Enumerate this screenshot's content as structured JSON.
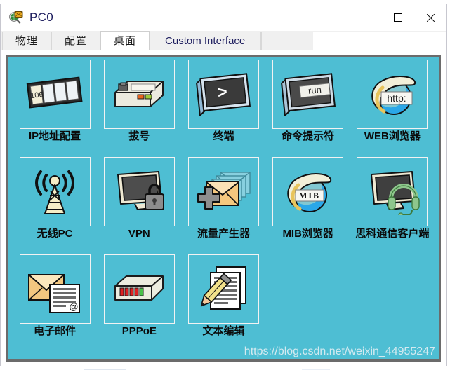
{
  "background_strip": {
    "ghost_text": "——  —————   ———    ——————    ————   ————————   ———"
  },
  "window": {
    "title": "PC0",
    "title_icon": "globe-magnifier-envelope-icon",
    "controls": {
      "minimize": "minimize-icon",
      "maximize": "maximize-icon",
      "close": "close-icon"
    }
  },
  "tabs": [
    {
      "label": "物理",
      "name": "tab-physical",
      "active": false,
      "cjk": true
    },
    {
      "label": "配置",
      "name": "tab-config",
      "active": false,
      "cjk": true
    },
    {
      "label": "桌面",
      "name": "tab-desktop",
      "active": true,
      "cjk": true
    },
    {
      "label": "Custom Interface",
      "name": "tab-custom-interface",
      "active": false,
      "cjk": false
    }
  ],
  "desktop": {
    "background_color": "#4ebed3",
    "border_color": "#6b6b6b",
    "items": [
      {
        "label": "IP地址配置",
        "icon": "ip-configuration-icon",
        "name": "desktop-item-ip-configuration"
      },
      {
        "label": "拔号",
        "icon": "dial-up-modem-icon",
        "name": "desktop-item-dial-up"
      },
      {
        "label": "终端",
        "icon": "terminal-icon",
        "name": "desktop-item-terminal"
      },
      {
        "label": "命令提示符",
        "icon": "command-prompt-run-icon",
        "name": "desktop-item-command-prompt"
      },
      {
        "label": "WEB浏览器",
        "icon": "web-browser-http-globe-icon",
        "name": "desktop-item-web-browser"
      },
      {
        "label": "无线PC",
        "icon": "wireless-antenna-icon",
        "name": "desktop-item-wireless-pc"
      },
      {
        "label": "VPN",
        "icon": "monitor-lock-icon",
        "name": "desktop-item-vpn"
      },
      {
        "label": "流量产生器",
        "icon": "envelope-stack-plus-icon",
        "name": "desktop-item-traffic-generator"
      },
      {
        "label": "MIB浏览器",
        "icon": "mib-browser-globe-icon",
        "name": "desktop-item-mib-browser"
      },
      {
        "label": "思科通信客户端",
        "icon": "monitor-headset-icon",
        "name": "desktop-item-cisco-ip-communicator"
      },
      {
        "label": "电子邮件",
        "icon": "email-envelope-document-icon",
        "name": "desktop-item-email"
      },
      {
        "label": "PPPoE",
        "icon": "pppoe-modem-icon",
        "name": "desktop-item-pppoe"
      },
      {
        "label": "文本编辑",
        "icon": "text-editor-pencil-icon",
        "name": "desktop-item-text-editor"
      }
    ],
    "icon_labels": {
      "ip_config_number": "106",
      "terminal_prompt": ">",
      "command_prompt_text": "run",
      "browser_text": "http:",
      "mib_text": "MIB",
      "email_at": "@"
    }
  },
  "watermark": {
    "text": "https://blog.csdn.net/weixin_44955247"
  }
}
